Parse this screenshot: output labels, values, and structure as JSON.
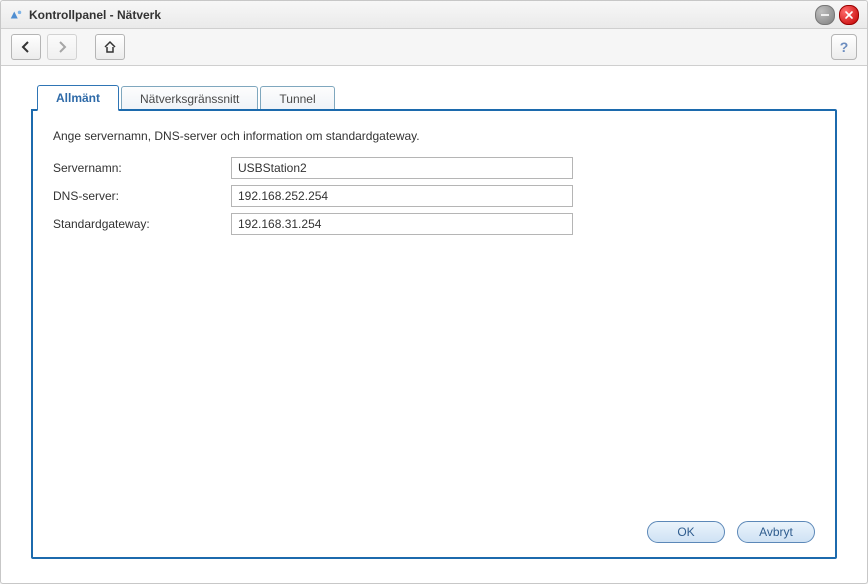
{
  "window": {
    "title": "Kontrollpanel - Nätverk"
  },
  "tabs": {
    "general": "Allmänt",
    "interface": "Nätverksgränssnitt",
    "tunnel": "Tunnel"
  },
  "panel": {
    "intro": "Ange servernamn, DNS-server och information om standardgateway.",
    "fields": {
      "servername": {
        "label": "Servernamn:",
        "value": "USBStation2"
      },
      "dns": {
        "label": "DNS-server:",
        "value": "192.168.252.254"
      },
      "gateway": {
        "label": "Standardgateway:",
        "value": "192.168.31.254"
      }
    },
    "buttons": {
      "ok": "OK",
      "cancel": "Avbryt"
    }
  },
  "toolbar": {
    "help": "?"
  }
}
